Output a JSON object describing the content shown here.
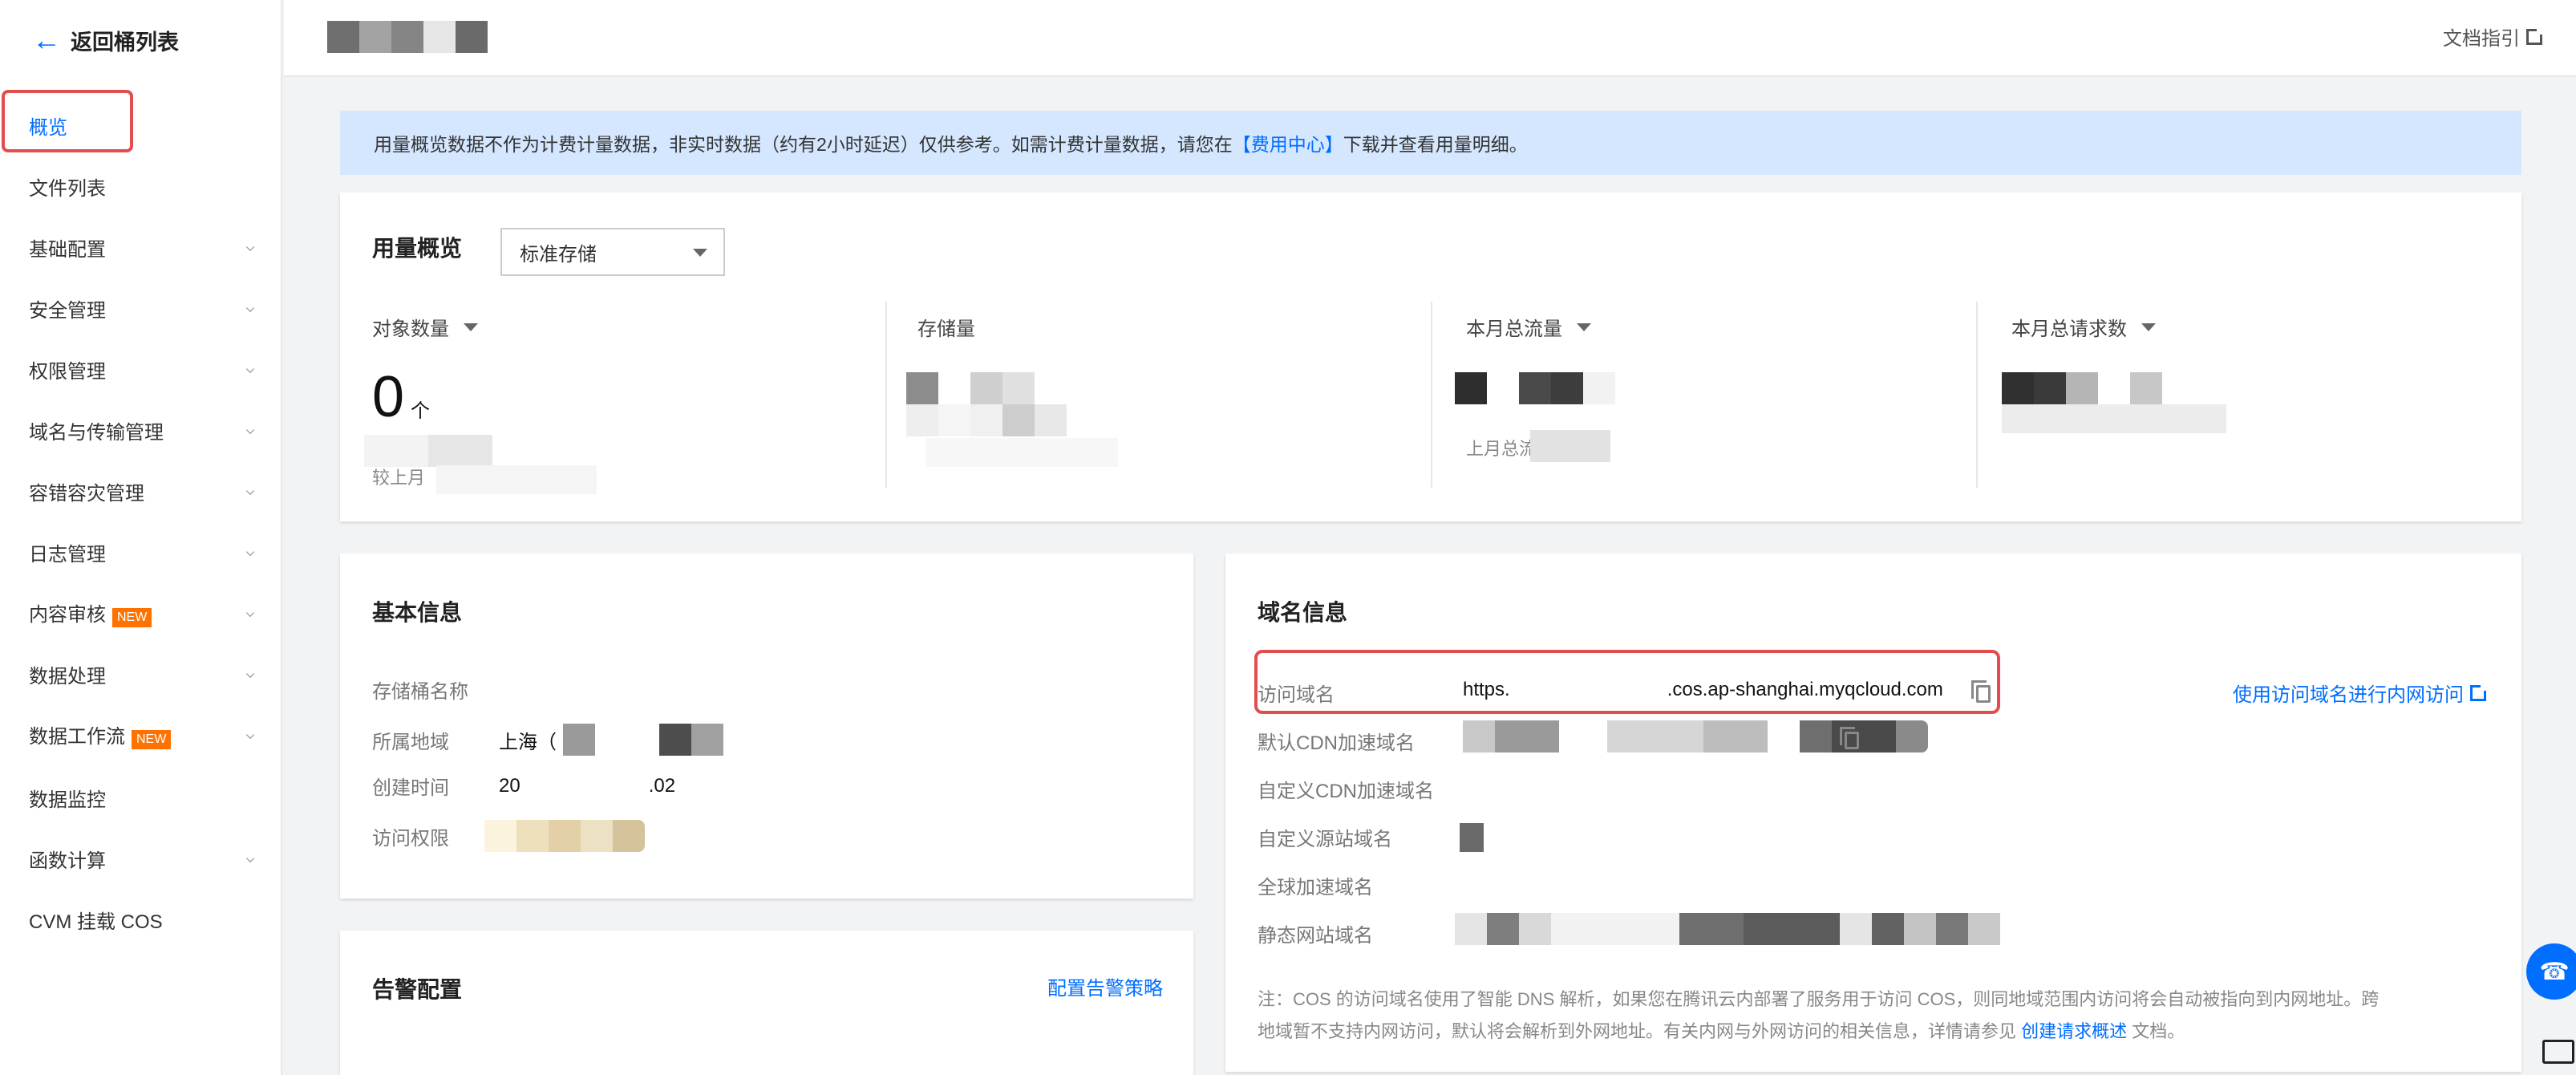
{
  "sidebar": {
    "back_label": "返回桶列表",
    "items": [
      {
        "label": "概览",
        "active": true,
        "chevron": false
      },
      {
        "label": "文件列表",
        "chevron": false
      },
      {
        "label": "基础配置",
        "chevron": true
      },
      {
        "label": "安全管理",
        "chevron": true
      },
      {
        "label": "权限管理",
        "chevron": true
      },
      {
        "label": "域名与传输管理",
        "chevron": true
      },
      {
        "label": "容错容灾管理",
        "chevron": true
      },
      {
        "label": "日志管理",
        "chevron": true
      },
      {
        "label": "内容审核",
        "badge": "NEW",
        "chevron": true
      },
      {
        "label": "数据处理",
        "chevron": true
      },
      {
        "label": "数据工作流",
        "badge": "NEW",
        "chevron": true
      },
      {
        "label": "数据监控",
        "chevron": false
      },
      {
        "label": "函数计算",
        "chevron": true
      },
      {
        "label": "CVM 挂载 COS",
        "chevron": false
      }
    ]
  },
  "header": {
    "doc_link": "文档指引"
  },
  "notice": {
    "text_before": "用量概览数据不作为计费计量数据，非实时数据（约有2小时延迟）仅供参考。如需计费计量数据，请您在",
    "link": "【费用中心】",
    "text_after": "下载并查看用量明细。"
  },
  "usage": {
    "title": "用量概览",
    "storage_class": "标准存储",
    "metrics": {
      "objects_label": "对象数量",
      "objects_value": "0",
      "objects_unit": "个",
      "objects_compare": "较上月",
      "storage_label": "存储量",
      "traffic_label": "本月总流量",
      "traffic_compare": "上月总流",
      "requests_label": "本月总请求数"
    }
  },
  "basic": {
    "title": "基本信息",
    "rows": {
      "name_label": "存储桶名称",
      "region_label": "所属地域",
      "region_value": "上海（",
      "created_label": "创建时间",
      "created_prefix": "20",
      "created_suffix": ".02",
      "access_label": "访问权限"
    }
  },
  "domain": {
    "title": "域名信息",
    "access_label": "访问域名",
    "url_prefix": "https.",
    "url_suffix": ".cos.ap-shanghai.myqcloud.com",
    "intranet_link": "使用访问域名进行内网访问",
    "rows": {
      "cdn_default": "默认CDN加速域名",
      "cdn_custom": "自定义CDN加速域名",
      "origin_custom": "自定义源站域名",
      "global_accel": "全球加速域名",
      "static_site": "静态网站域名"
    },
    "note_line1": "注：COS 的访问域名使用了智能 DNS 解析，如果您在腾讯云内部署了服务用于访问 COS，则同地域范围内访问将会自动被指向到内网地址。跨",
    "note_line2_before": "地域暂不支持内网访问，默认将会解析到外网地址。有关内网与外网访问的相关信息，详情请参见",
    "note_link": "创建请求概述",
    "note_line2_after": "文档。"
  },
  "alerts": {
    "title": "告警配置",
    "config_link": "配置告警策略"
  },
  "colors": {
    "accent": "#006eff",
    "highlight": "#e34d4d",
    "badge": "#ff7200",
    "notice_bg": "#d5e7ff"
  }
}
